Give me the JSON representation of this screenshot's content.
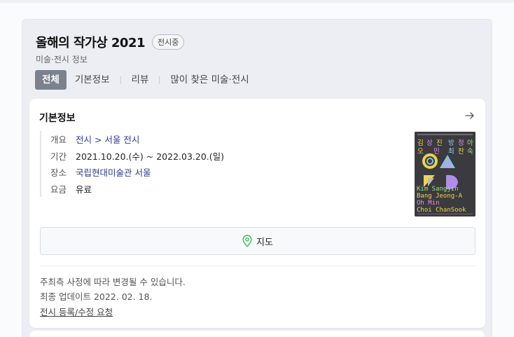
{
  "header": {
    "title": "올해의 작가상 2021",
    "badge": "전시중",
    "subtitle": "미술·전시 정보"
  },
  "tabs": [
    {
      "label": "전체",
      "active": true
    },
    {
      "label": "기본정보",
      "active": false
    },
    {
      "label": "리뷰",
      "active": false
    },
    {
      "label": "많이 찾은 미술·전시",
      "active": false
    }
  ],
  "basic_info": {
    "title": "기본정보",
    "rows": [
      {
        "key": "개요",
        "value": "전시 > 서울 전시"
      },
      {
        "key": "기간",
        "value": "2021.10.20.(수) ~ 2022.03.20.(일)"
      },
      {
        "key": "장소",
        "value": "국립현대미술관 서울"
      },
      {
        "key": "요금",
        "value": "유료"
      }
    ],
    "map_button": "지도"
  },
  "poster": {
    "kr_line1": [
      "김",
      "상",
      "진",
      "방",
      "정",
      "아"
    ],
    "kr_line2": [
      "오",
      "민",
      "최",
      "찬",
      "숙"
    ],
    "en_lines": [
      "Kim Sangjin",
      "Bang Jeong-A",
      "Oh    Min",
      "Choi ChanSook"
    ]
  },
  "notes": {
    "disclaimer": "주최측 사정에 따라 변경될 수 있습니다.",
    "updated": "최종 업데이트 2022. 02. 18.",
    "report_link": "전시 등록/수정 요청"
  },
  "icons": {
    "arrow": "arrow-right-icon",
    "map": "map-pin-icon"
  },
  "colors": {
    "active_tab": "#7b828e",
    "link": "#2d3f8e",
    "pin": "#3cbf5a"
  }
}
